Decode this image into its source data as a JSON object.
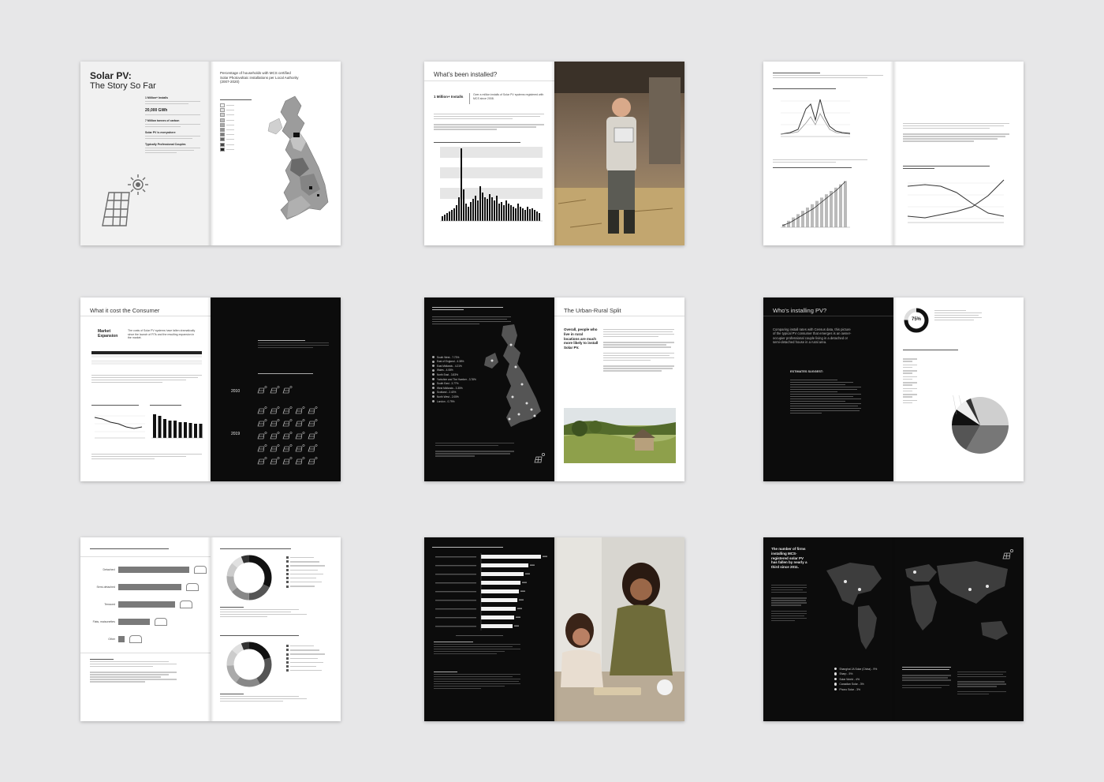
{
  "spreads": [
    {
      "title_line1": "Solar PV:",
      "title_line2": "The Story So Far",
      "stats": [
        {
          "heading": "1 Million+ Installs"
        },
        {
          "heading": "20,000 GWh"
        },
        {
          "heading": "7 Million tonnes of carbon"
        },
        {
          "heading": "Solar PV is everywhere"
        },
        {
          "heading": "Typically Professional Couples"
        }
      ],
      "right_title": "Percentage of households with MCS certified Solar Photovoltaic installations per Local Authority (2007-2020)"
    },
    {
      "title": "What's been installed?",
      "stat": "1 Million+ Installs",
      "stat_desc": "Over a million installs of Solar PV systems registered with MCS since 2008."
    },
    {
      "title": ""
    },
    {
      "title": "What it cost the Consumer",
      "sub": "Market Expansion",
      "sub_desc": "The costs of Solar PV systems have fallen dramatically since the launch of FITs and the resulting expansion in the market.",
      "year1": "2010",
      "year2": "2019"
    },
    {
      "title": "The Urban-Rural Split",
      "quote": "Overall, people who live in rural locations are much more likely to install Solar PV.",
      "regions": [
        "South West - 7.73%",
        "East of England - 4.38%",
        "East Midlands - 4.21%",
        "Wales - 4.08%",
        "North East - 3.83%",
        "Yorkshire and The Humber - 3.78%",
        "South East - 3.77%",
        "West Midlands - 3.35%",
        "Scotland - 2.43%",
        "North West - 2.05%",
        "London - 0.79%"
      ]
    },
    {
      "title": "Who's installing PV?",
      "percent": "75%",
      "intro": "Comparing install rates with Census data, this picture of the typical PV consumer that emerges is an owner-occupier professional couple living in a detached or semi-detached house in a rural area.",
      "estimates_label": "ESTIMATES SUGGEST:"
    },
    {
      "property_types": [
        "Detached",
        "Semi-detached",
        "Terraced",
        "Flats, maisonettes",
        "Other"
      ]
    },
    {
      "title": ""
    },
    {
      "headline": "The number of firms installing MCS-registered solar PV has fallen by nearly a third since 2011.",
      "manufacturers": [
        "Shanghai JA Solar (China) - 9%",
        "Sharp - 5%",
        "Solar World - 4%",
        "Canadian Solar - 3%",
        "Phono Solar - 3%"
      ]
    }
  ],
  "colors": {
    "background": "#e7e7e8",
    "page": "#ffffff",
    "dark_page": "#0c0c0c",
    "accent": "#4a4a4a"
  }
}
